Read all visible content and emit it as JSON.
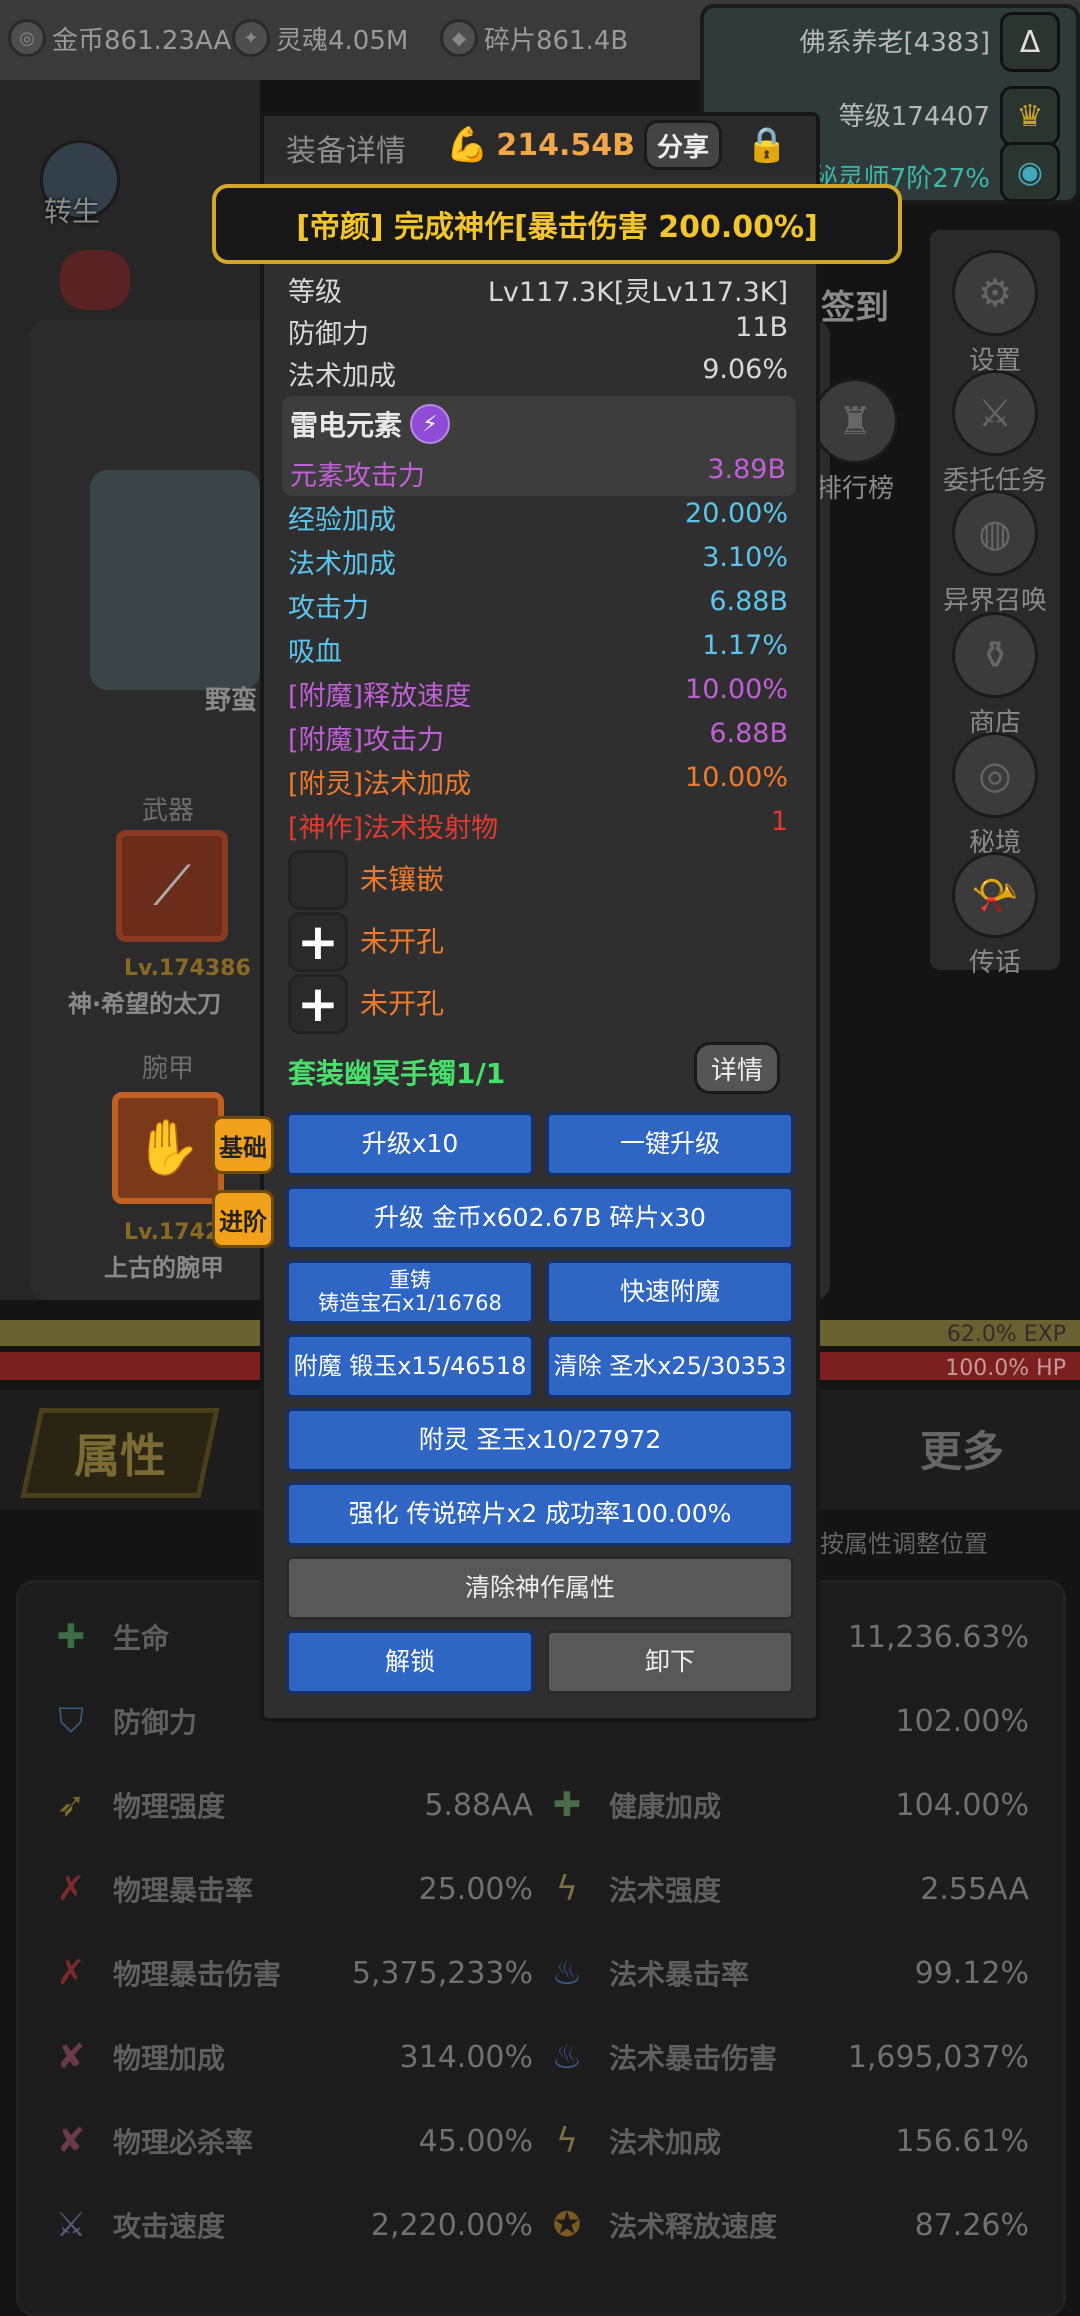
{
  "top_resources": [
    {
      "icon": "gold-coin-icon",
      "text": "金币861.23AA"
    },
    {
      "icon": "soul-icon",
      "text": "灵魂4.05M"
    },
    {
      "icon": "shard-icon",
      "text": "碎片861.4B"
    }
  ],
  "profile": {
    "name": "佛系养老[4383]",
    "level": "等级174407",
    "rank": "秘灵师7阶27%"
  },
  "left_menu": {
    "rebirth": "转生"
  },
  "right_menu": [
    "签到",
    "设置",
    "排行榜",
    "委托任务",
    "异界召唤",
    "商店",
    "秘境",
    "传话"
  ],
  "background_labels": {
    "barbarian": "野蛮"
  },
  "equip_slots": [
    {
      "category": "武器",
      "level": "Lv.174386",
      "name": "神·希望的太刀"
    },
    {
      "category": "腕甲",
      "level": "Lv.1742",
      "name": "上古的腕甲"
    }
  ],
  "bars": {
    "exp": "62.0% EXP",
    "hp": "100.0%   HP"
  },
  "bottom_tabs": {
    "attributes": "属性",
    "more": "更多"
  },
  "sort_hint": "按属性调整位置",
  "stats_left": [
    {
      "icon": "life-icon",
      "name": "生命",
      "value": ""
    },
    {
      "icon": "shield-icon",
      "name": "防御力",
      "value": ""
    },
    {
      "icon": "physical-strength-icon",
      "name": "物理强度",
      "value": "5.88AA"
    },
    {
      "icon": "physical-crit-icon",
      "name": "物理暴击率",
      "value": "25.00%"
    },
    {
      "icon": "physical-crit-damage-icon",
      "name": "物理暴击伤害",
      "value": "5,375,233%"
    },
    {
      "icon": "physical-bonus-icon",
      "name": "物理加成",
      "value": "314.00%"
    },
    {
      "icon": "physical-kill-icon",
      "name": "物理必杀率",
      "value": "45.00%"
    },
    {
      "icon": "attack-speed-icon",
      "name": "攻击速度",
      "value": "2,220.00%"
    }
  ],
  "stats_right": [
    {
      "icon": "",
      "name": "",
      "value": "11,236.63%"
    },
    {
      "icon": "",
      "name": "",
      "value": "102.00%"
    },
    {
      "icon": "health-bonus-icon",
      "name": "健康加成",
      "value": "104.00%"
    },
    {
      "icon": "spell-strength-icon",
      "name": "法术强度",
      "value": "2.55AA"
    },
    {
      "icon": "spell-crit-icon",
      "name": "法术暴击率",
      "value": "99.12%"
    },
    {
      "icon": "spell-crit-damage-icon",
      "name": "法术暴击伤害",
      "value": "1,695,037%"
    },
    {
      "icon": "spell-bonus-icon",
      "name": "法术加成",
      "value": "156.61%"
    },
    {
      "icon": "cast-speed-icon",
      "name": "法术释放速度",
      "value": "87.26%"
    }
  ],
  "modal": {
    "title": "装备详情",
    "power": "214.54B",
    "share": "分享",
    "banner": "[帝颜] 完成神作[暴击伤害 200.00%]",
    "base_stats": [
      {
        "label": "等级",
        "value": "Lv117.3K[灵Lv117.3K]"
      },
      {
        "label": "防御力",
        "value": "11B"
      },
      {
        "label": "法术加成",
        "value": "9.06%"
      }
    ],
    "element": {
      "title": "雷电元素",
      "stat_label": "元素攻击力",
      "stat_value": "3.89B"
    },
    "extra_stats": [
      {
        "label": "经验加成",
        "value": "20.00%",
        "color": "#5dc4ec"
      },
      {
        "label": "法术加成",
        "value": "3.10%",
        "color": "#5dc4ec"
      },
      {
        "label": "攻击力",
        "value": "6.88B",
        "color": "#5dc4ec"
      },
      {
        "label": "吸血",
        "value": "1.17%",
        "color": "#5dc4ec"
      },
      {
        "label": "[附魔]释放速度",
        "value": "10.00%",
        "color": "#c05fd6"
      },
      {
        "label": "[附魔]攻击力",
        "value": "6.88B",
        "color": "#c05fd6"
      },
      {
        "label": "[附灵]法术加成",
        "value": "10.00%",
        "color": "#ee7a2e"
      },
      {
        "label": "[神作]法术投射物",
        "value": "1",
        "color": "#e23a30"
      }
    ],
    "sockets": [
      {
        "text": "未镶嵌"
      },
      {
        "text": "未开孔"
      },
      {
        "text": "未开孔"
      }
    ],
    "set_name": "套装幽冥手镯1/1",
    "detail_btn": "详情",
    "tag_basic": "基础",
    "tag_advanced": "进阶",
    "buttons": {
      "upgrade10": "升级x10",
      "one_click_upgrade": "一键升级",
      "upgrade_cost": "升级 金币x602.67B 碎片x30",
      "recast_1": "重铸",
      "recast_2": "铸造宝石x1/16768",
      "quick_enchant": "快速附魔",
      "enchant": "附魔 锻玉x15/46518",
      "clear": "清除 圣水x25/30353",
      "spirit": "附灵 圣玉x10/27972",
      "strengthen": "强化 传说碎片x2 成功率100.00%",
      "clear_masterwork": "清除神作属性",
      "unlock": "解锁",
      "unequip": "卸下"
    }
  }
}
